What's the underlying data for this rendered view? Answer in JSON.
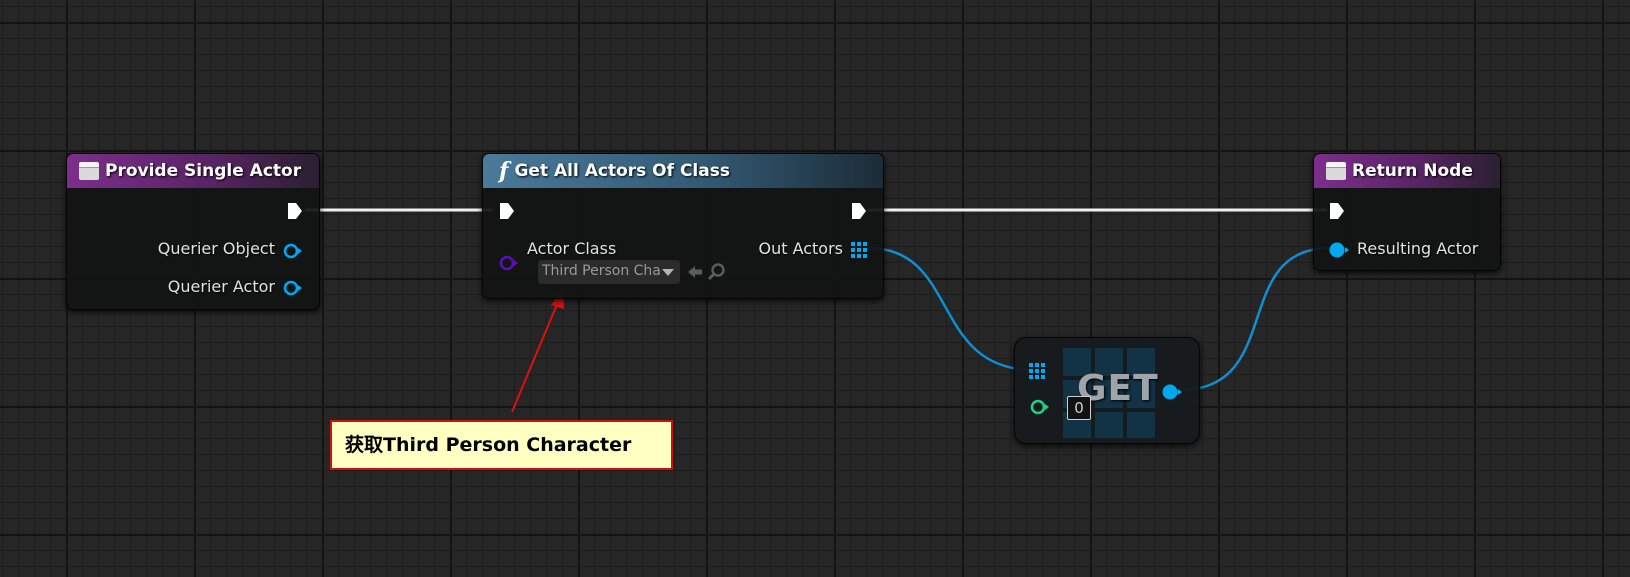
{
  "colors": {
    "exec": "#ffffff",
    "object_pin": "#00a8f0",
    "class_pin": "#5a0fb4",
    "integer_pin": "#1ecf8c",
    "annotation": "#e01010"
  },
  "nodes": {
    "provide_single_actor": {
      "title": "Provide Single Actor",
      "icon": "event-icon",
      "pins": {
        "querier_object": "Querier Object",
        "querier_actor": "Querier Actor"
      }
    },
    "get_all_actors": {
      "title": "Get All Actors Of Class",
      "icon": "function-icon",
      "pins": {
        "actor_class": "Actor Class",
        "actor_class_value": "Third Person Cha",
        "out_actors": "Out Actors"
      }
    },
    "return_node": {
      "title": "Return Node",
      "icon": "event-icon",
      "pins": {
        "resulting_actor": "Resulting Actor"
      }
    },
    "get": {
      "title": "GET",
      "index_value": "0"
    }
  },
  "annotation": {
    "text": "获取Third Person Character"
  }
}
